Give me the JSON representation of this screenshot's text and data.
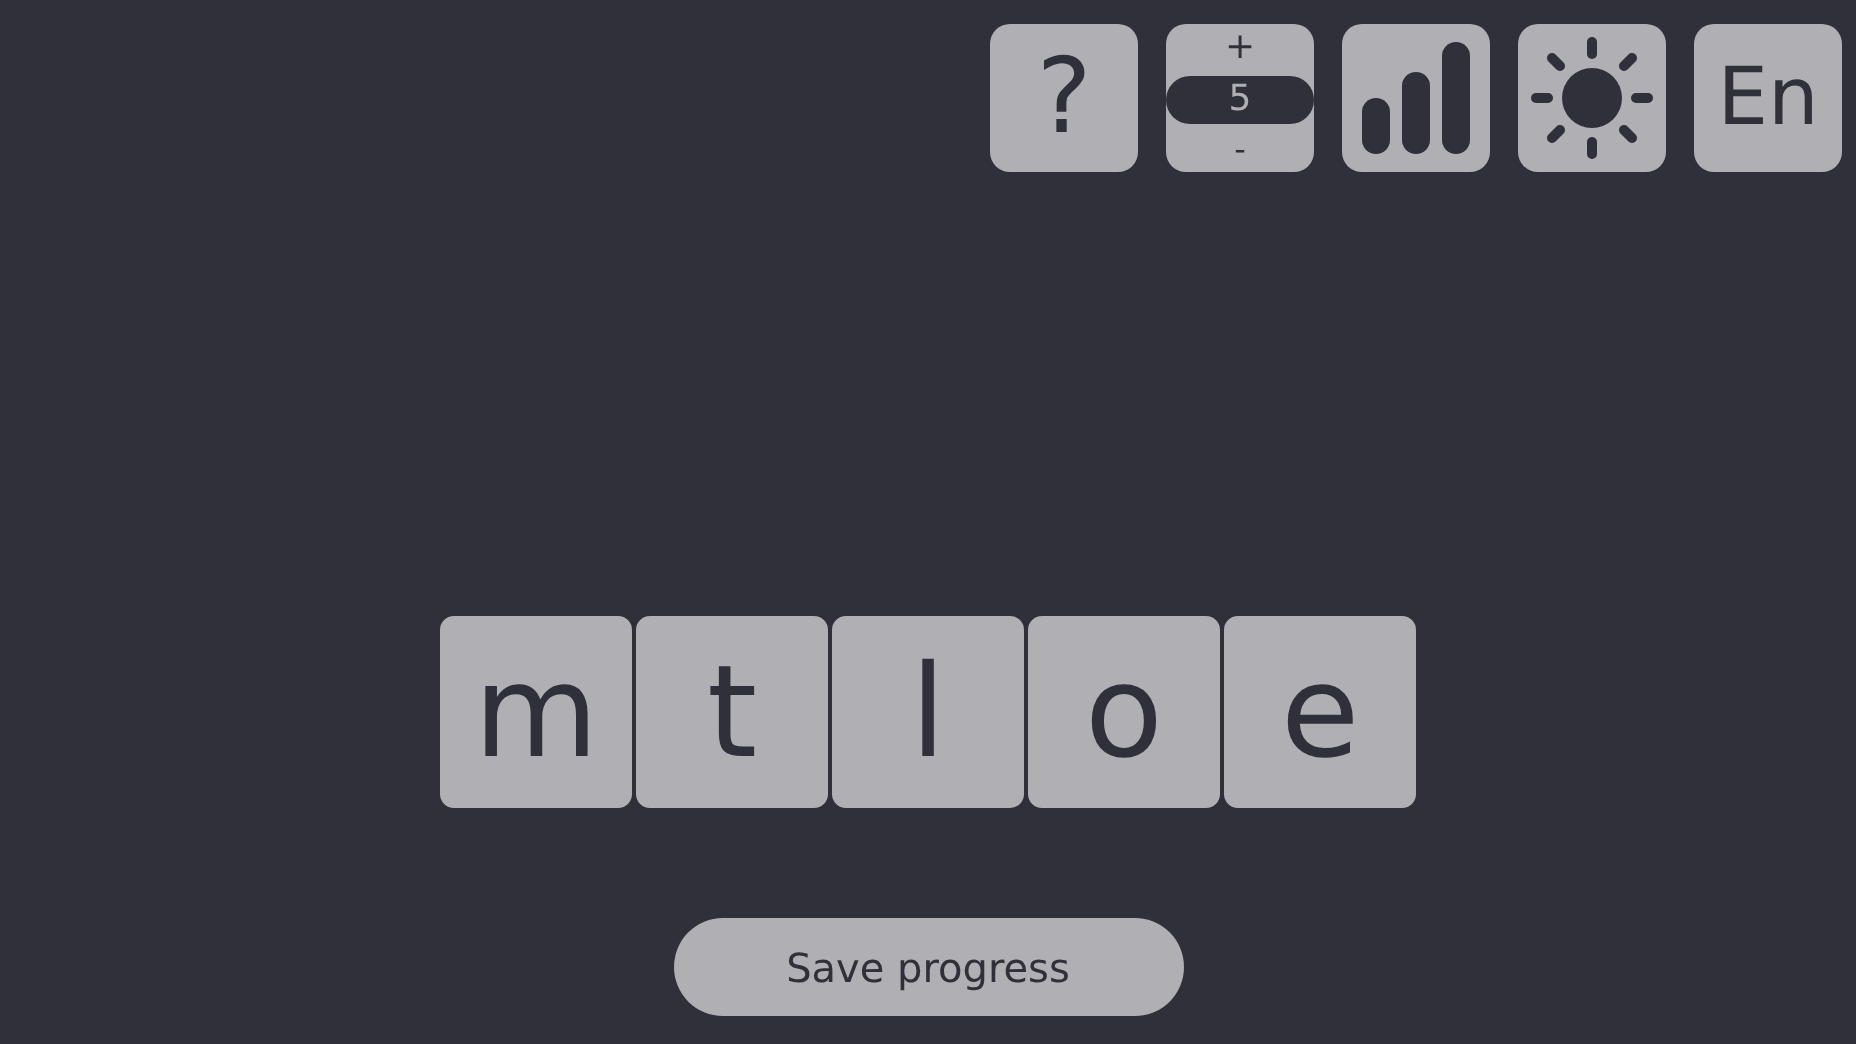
{
  "toolbar": {
    "help": "?",
    "stepper": {
      "plus": "+",
      "value": "5",
      "minus": "-"
    },
    "language": "En"
  },
  "tiles": [
    {
      "letter": "m"
    },
    {
      "letter": "t"
    },
    {
      "letter": "l"
    },
    {
      "letter": "o"
    },
    {
      "letter": "e"
    }
  ],
  "save_button": "Save progress"
}
